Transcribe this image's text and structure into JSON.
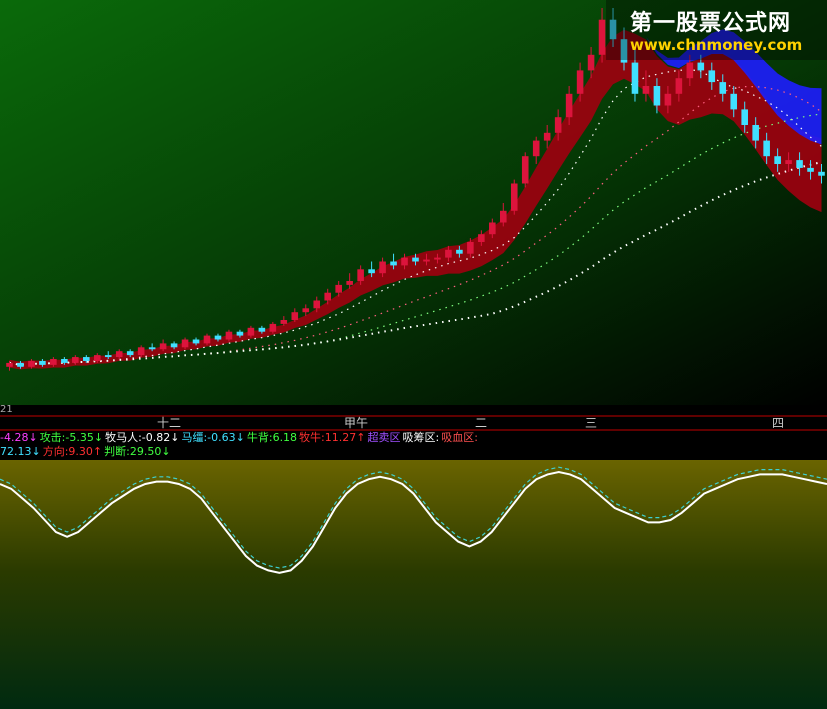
{
  "watermark": {
    "title": "第一股票公式网",
    "url": "www.chnmoney.com"
  },
  "axis": {
    "row_label": "21",
    "ticks": [
      {
        "label": "十二",
        "idx": 14
      },
      {
        "label": "甲午",
        "idx": 31
      },
      {
        "label": "二",
        "idx": 43
      },
      {
        "label": "三",
        "idx": 53
      },
      {
        "label": "四",
        "idx": 70
      }
    ]
  },
  "colors": {
    "up_candle": "#dc143c",
    "down_candle": "#40e0ff",
    "band_red": "#a00010",
    "band_blue": "#1e1eff",
    "osc_white": "#ffffff",
    "osc_cyan": "#3fd0d0",
    "osc_red": "#ff2020",
    "osc_green": "#20d040"
  },
  "indicator_row1": [
    {
      "text": "-4.28↓",
      "color": "#ff40ff"
    },
    {
      "text": "攻击:-5.35↓",
      "color": "#40ff40"
    },
    {
      "text": "牧马人:-0.82↓",
      "color": "#ffffff"
    },
    {
      "text": "马缰:-0.63↓",
      "color": "#40e0ff"
    },
    {
      "text": "牛背:6.18",
      "color": "#40ff40"
    },
    {
      "text": "牧牛:11.27↑",
      "color": "#ff3030"
    },
    {
      "text": "超卖区",
      "color": "#a050ff"
    },
    {
      "text": "吸筹区:",
      "color": "#ffffff"
    },
    {
      "text": "吸血区:",
      "color": "#ff5050"
    }
  ],
  "indicator_row2": [
    {
      "text": "72.13↓",
      "color": "#40e0ff"
    },
    {
      "text": "方向:9.30↑",
      "color": "#ff3030"
    },
    {
      "text": "判断:29.50↓",
      "color": "#40ff40"
    }
  ],
  "chart_data": [
    {
      "type": "candlestick",
      "count": 75,
      "ylim": [
        0,
        100
      ],
      "candles": [
        [
          8,
          9,
          7,
          9.5
        ],
        [
          9,
          8,
          7.5,
          9.5
        ],
        [
          8,
          9.5,
          7.5,
          10
        ],
        [
          9.5,
          8.5,
          8,
          10
        ],
        [
          8.5,
          10,
          8,
          10.5
        ],
        [
          10,
          9,
          8.5,
          10.5
        ],
        [
          9,
          10.5,
          8.5,
          11
        ],
        [
          10.5,
          9.5,
          9,
          11
        ],
        [
          9.5,
          11,
          9,
          11.5
        ],
        [
          11,
          10.5,
          10,
          12
        ],
        [
          10.5,
          12,
          10,
          12.5
        ],
        [
          12,
          11,
          10.5,
          12.5
        ],
        [
          11,
          13,
          10.5,
          13.5
        ],
        [
          13,
          12.5,
          12,
          14
        ],
        [
          12.5,
          14,
          12,
          15
        ],
        [
          14,
          13,
          12.5,
          14.5
        ],
        [
          13,
          15,
          12.5,
          15.5
        ],
        [
          15,
          14,
          13.5,
          15.5
        ],
        [
          14,
          16,
          13.5,
          16.5
        ],
        [
          16,
          15,
          14.5,
          16.5
        ],
        [
          15,
          17,
          14.5,
          17.5
        ],
        [
          17,
          16,
          15.5,
          17.5
        ],
        [
          16,
          18,
          15.5,
          18.5
        ],
        [
          18,
          17,
          16.5,
          18.5
        ],
        [
          17,
          19,
          16.5,
          19.5
        ],
        [
          19,
          20,
          18.5,
          21
        ],
        [
          20,
          22,
          19.5,
          23
        ],
        [
          22,
          23,
          21,
          24
        ],
        [
          23,
          25,
          22,
          26
        ],
        [
          25,
          27,
          24,
          28
        ],
        [
          27,
          29,
          26,
          30
        ],
        [
          29,
          30,
          28,
          32
        ],
        [
          30,
          33,
          29,
          34
        ],
        [
          33,
          32,
          31,
          35
        ],
        [
          32,
          35,
          31,
          36
        ],
        [
          35,
          34,
          33,
          37
        ],
        [
          34,
          36,
          33,
          37
        ],
        [
          36,
          35,
          34,
          37
        ],
        [
          35,
          35.5,
          34,
          37
        ],
        [
          35.5,
          36,
          34.5,
          37
        ],
        [
          36,
          38,
          35,
          39
        ],
        [
          38,
          37,
          36,
          39
        ],
        [
          37,
          40,
          36,
          41
        ],
        [
          40,
          42,
          39,
          43
        ],
        [
          42,
          45,
          41,
          46
        ],
        [
          45,
          48,
          44,
          50
        ],
        [
          48,
          55,
          47,
          56
        ],
        [
          55,
          62,
          54,
          63
        ],
        [
          62,
          66,
          60,
          67
        ],
        [
          66,
          68,
          64,
          70
        ],
        [
          68,
          72,
          66,
          74
        ],
        [
          72,
          78,
          70,
          80
        ],
        [
          78,
          84,
          76,
          86
        ],
        [
          84,
          88,
          82,
          90
        ],
        [
          88,
          97,
          86,
          100
        ],
        [
          97,
          92,
          90,
          100
        ],
        [
          92,
          86,
          84,
          95
        ],
        [
          86,
          78,
          76,
          90
        ],
        [
          78,
          80,
          76,
          84
        ],
        [
          80,
          75,
          73,
          82
        ],
        [
          75,
          78,
          73,
          80
        ],
        [
          78,
          82,
          76,
          84
        ],
        [
          82,
          86,
          80,
          88
        ],
        [
          86,
          84,
          82,
          88
        ],
        [
          84,
          81,
          79,
          86
        ],
        [
          81,
          78,
          76,
          83
        ],
        [
          78,
          74,
          72,
          80
        ],
        [
          74,
          70,
          68,
          76
        ],
        [
          70,
          66,
          64,
          72
        ],
        [
          66,
          62,
          60,
          68
        ],
        [
          62,
          60,
          58,
          64
        ],
        [
          60,
          61,
          58,
          63
        ],
        [
          61,
          59,
          57,
          63
        ],
        [
          59,
          58,
          56,
          61
        ],
        [
          58,
          57,
          55,
          60
        ]
      ]
    },
    {
      "type": "line",
      "ylim": [
        0,
        100
      ],
      "series": [
        {
          "values": [
            90,
            88,
            84,
            80,
            75,
            70,
            68,
            70,
            74,
            78,
            82,
            85,
            88,
            90,
            91,
            91,
            90,
            88,
            84,
            78,
            72,
            66,
            60,
            56,
            54,
            53,
            54,
            58,
            64,
            72,
            80,
            86,
            90,
            92,
            93,
            92,
            90,
            86,
            80,
            74,
            70,
            66,
            64,
            66,
            70,
            76,
            82,
            88,
            92,
            94,
            95,
            94,
            92,
            88,
            84,
            80,
            78,
            76,
            74,
            74,
            75,
            78,
            82,
            86,
            88,
            90,
            92,
            93,
            94,
            94,
            94,
            93,
            92,
            91,
            90
          ]
        },
        {
          "values": [
            92,
            90,
            86,
            82,
            77,
            72,
            70,
            72,
            76,
            80,
            84,
            87,
            90,
            92,
            93,
            93,
            92,
            90,
            86,
            80,
            74,
            68,
            62,
            58,
            56,
            55,
            56,
            60,
            66,
            74,
            82,
            88,
            92,
            94,
            95,
            94,
            92,
            88,
            82,
            76,
            72,
            68,
            66,
            68,
            72,
            78,
            84,
            90,
            94,
            96,
            97,
            96,
            94,
            90,
            86,
            82,
            80,
            78,
            76,
            76,
            77,
            80,
            84,
            88,
            90,
            92,
            94,
            95,
            96,
            96,
            96,
            95,
            94,
            93,
            92
          ]
        }
      ]
    }
  ]
}
